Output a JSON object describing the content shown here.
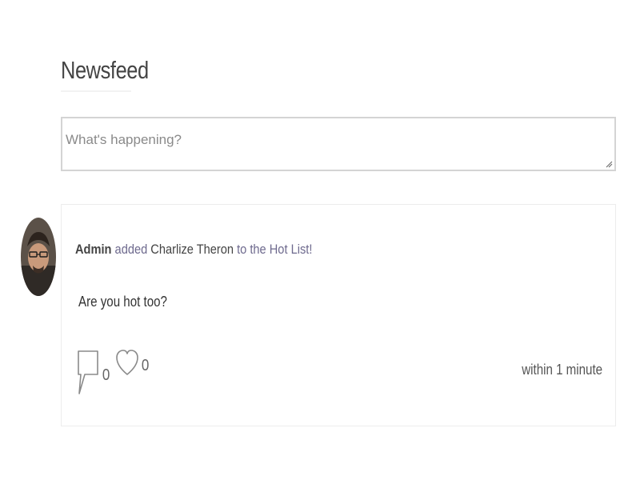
{
  "newsfeed": {
    "title": "Newsfeed"
  },
  "composer": {
    "placeholder": "What's happening?",
    "value": ""
  },
  "post": {
    "actor": "Admin",
    "verb": "added",
    "target": "Charlize Theron",
    "suffix": "to the Hot List!",
    "body": "Are you hot too?",
    "comment_count": "0",
    "like_count": "0",
    "timestamp": "within 1 minute",
    "avatar_icon": "user-avatar",
    "comment_icon": "comment-bubble-icon",
    "like_icon": "heart-outline-icon"
  },
  "colors": {
    "link_purple": "#6e6a8e",
    "border": "#d4d4d4",
    "card_border": "#ececec",
    "text": "#333333"
  }
}
